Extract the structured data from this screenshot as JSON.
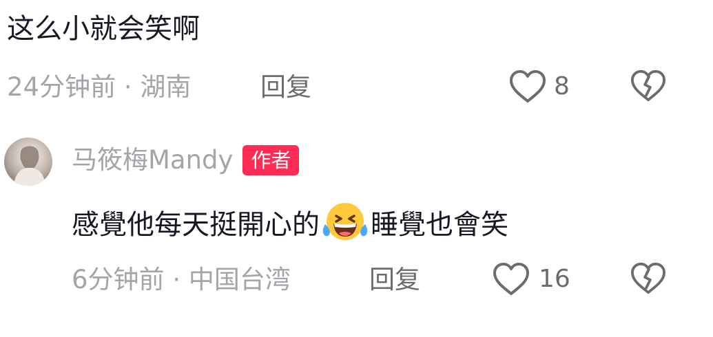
{
  "comment1": {
    "text": "这么小就会笑啊",
    "time": "24分钟前",
    "separator": "·",
    "location": "湖南",
    "reply_label": "回复",
    "like_count": "8"
  },
  "comment2": {
    "username": "马筱梅Mandy",
    "badge": "作者",
    "text_before_emoji": "感覺他每天挺開心的",
    "emoji": "laughing-crying-emoji",
    "text_after_emoji": "睡覺也會笑",
    "time": "6分钟前",
    "separator": "·",
    "location": "中国台湾",
    "reply_label": "回复",
    "like_count": "16"
  },
  "colors": {
    "badge_bg": "#fe2c55",
    "meta_text": "#a4a5aa",
    "primary_text": "#161823"
  }
}
